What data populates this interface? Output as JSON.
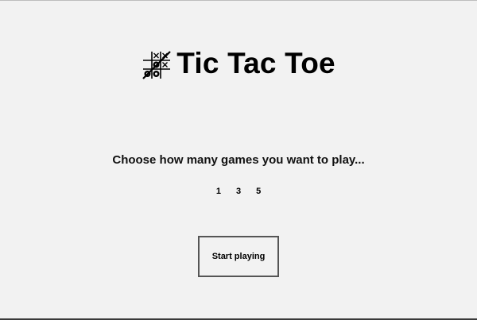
{
  "header": {
    "logo_icon": "tic-tac-toe-board-icon",
    "title": "Tic Tac Toe"
  },
  "prompt": "Choose how many games you want to play...",
  "game_count_options": [
    "1",
    "3",
    "5"
  ],
  "start_button": {
    "label": "Start playing"
  },
  "colors": {
    "background": "#f2f2f2",
    "text": "#000000",
    "button_border": "#555555"
  }
}
